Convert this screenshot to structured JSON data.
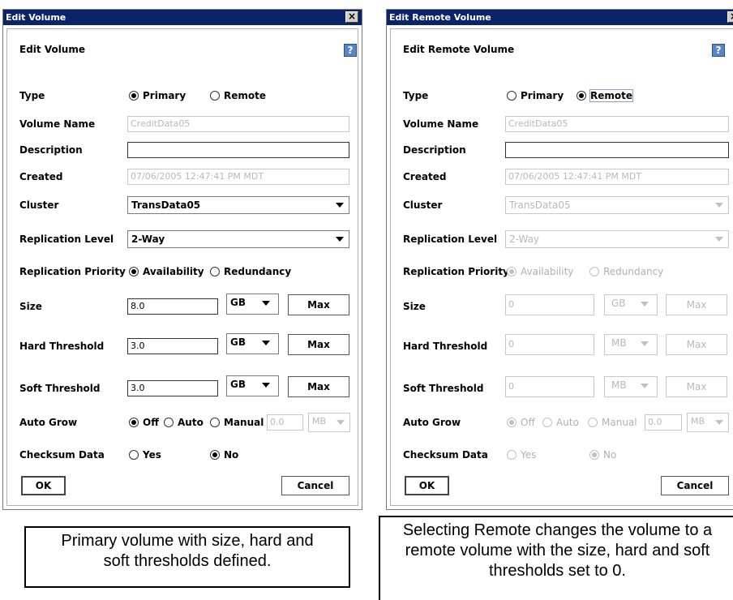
{
  "left": {
    "window_title": "Edit Volume",
    "heading": "Edit Volume",
    "labels": {
      "type": "Type",
      "volume_name": "Volume Name",
      "description": "Description",
      "created": "Created",
      "cluster": "Cluster",
      "replication_level": "Replication Level",
      "replication_priority": "Replication Priority",
      "size": "Size",
      "hard_threshold": "Hard Threshold",
      "soft_threshold": "Soft Threshold",
      "auto_grow": "Auto Grow",
      "checksum_data": "Checksum Data"
    },
    "type_options": [
      "Primary",
      "Remote"
    ],
    "type_selected": "Primary",
    "volume_name": "CreditData05",
    "description": "",
    "created": "07/06/2005 12:47:41 PM MDT",
    "cluster": "TransData05",
    "replication_level": "2-Way",
    "priority_options": [
      "Availability",
      "Redundancy"
    ],
    "size": {
      "value": "8.0",
      "unit": "GB"
    },
    "hard_threshold": {
      "value": "3.0",
      "unit": "GB"
    },
    "soft_threshold": {
      "value": "3.0",
      "unit": "GB"
    },
    "max_label": "Max",
    "auto_grow_options": [
      "Off",
      "Auto",
      "Manual"
    ],
    "auto_grow_value": "0.0",
    "auto_grow_unit": "MB",
    "checksum_options": [
      "Yes",
      "No"
    ],
    "ok_label": "OK",
    "cancel_label": "Cancel",
    "help_glyph": "?"
  },
  "right": {
    "window_title": "Edit Remote Volume",
    "heading": "Edit Remote Volume",
    "type_selected": "Remote",
    "volume_name": "CreditData05",
    "description": "",
    "created": "07/06/2005 12:47:41 PM MDT",
    "cluster": "TransData05",
    "replication_level": "2-Way",
    "size": {
      "value": "0",
      "unit": "GB"
    },
    "hard_threshold": {
      "value": "0",
      "unit": "MB"
    },
    "soft_threshold": {
      "value": "0",
      "unit": "MB"
    },
    "auto_grow_value": "0.0",
    "auto_grow_unit": "MB"
  },
  "captions": {
    "left": "Primary volume with size, hard and soft thresholds defined.",
    "right": "Selecting Remote changes the volume to a remote volume with the size, hard and soft thresholds set to 0."
  },
  "colors": {
    "titlebar": "#0a246a",
    "help_icon": "#5b86c6",
    "disabled_text": "#b8b8b8"
  }
}
